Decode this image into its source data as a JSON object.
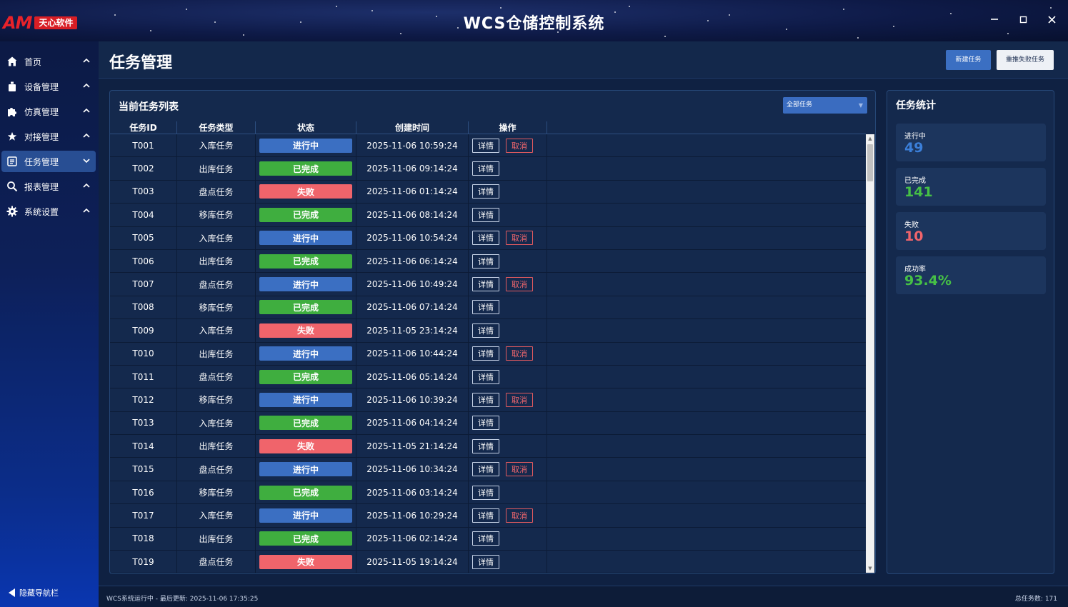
{
  "app": {
    "logo_text": "AM",
    "logo_tag": "天心软件",
    "title": "WCS仓储控制系统",
    "window_controls": [
      "minimize",
      "maximize",
      "close"
    ]
  },
  "sidebar": {
    "items": [
      {
        "label": "首页",
        "icon": "home-icon",
        "active": false
      },
      {
        "label": "设备管理",
        "icon": "device-icon",
        "active": false
      },
      {
        "label": "仿真管理",
        "icon": "puzzle-icon",
        "active": false
      },
      {
        "label": "对接管理",
        "icon": "star-icon",
        "active": false
      },
      {
        "label": "任务管理",
        "icon": "list-icon",
        "active": true
      },
      {
        "label": "报表管理",
        "icon": "search-icon",
        "active": false
      },
      {
        "label": "系统设置",
        "icon": "gear-icon",
        "active": false
      }
    ],
    "collapse_label": "隐藏导航栏"
  },
  "header": {
    "title": "任务管理",
    "new_task_label": "新建任务",
    "retry_failed_label": "重推失败任务"
  },
  "task_panel": {
    "title": "当前任务列表",
    "filter_value": "全部任务",
    "columns": [
      "任务ID",
      "任务类型",
      "状态",
      "创建时间",
      "操作"
    ],
    "detail_label": "详情",
    "cancel_label": "取消",
    "rows": [
      {
        "id": "T001",
        "type": "入库任务",
        "status": "进行中",
        "status_kind": "running",
        "created": "2025-11-06 10:59:24",
        "cancellable": true
      },
      {
        "id": "T002",
        "type": "出库任务",
        "status": "已完成",
        "status_kind": "done",
        "created": "2025-11-06 09:14:24",
        "cancellable": false
      },
      {
        "id": "T003",
        "type": "盘点任务",
        "status": "失败",
        "status_kind": "failed",
        "created": "2025-11-06 01:14:24",
        "cancellable": false
      },
      {
        "id": "T004",
        "type": "移库任务",
        "status": "已完成",
        "status_kind": "done",
        "created": "2025-11-06 08:14:24",
        "cancellable": false
      },
      {
        "id": "T005",
        "type": "入库任务",
        "status": "进行中",
        "status_kind": "running",
        "created": "2025-11-06 10:54:24",
        "cancellable": true
      },
      {
        "id": "T006",
        "type": "出库任务",
        "status": "已完成",
        "status_kind": "done",
        "created": "2025-11-06 06:14:24",
        "cancellable": false
      },
      {
        "id": "T007",
        "type": "盘点任务",
        "status": "进行中",
        "status_kind": "running",
        "created": "2025-11-06 10:49:24",
        "cancellable": true
      },
      {
        "id": "T008",
        "type": "移库任务",
        "status": "已完成",
        "status_kind": "done",
        "created": "2025-11-06 07:14:24",
        "cancellable": false
      },
      {
        "id": "T009",
        "type": "入库任务",
        "status": "失败",
        "status_kind": "failed",
        "created": "2025-11-05 23:14:24",
        "cancellable": false
      },
      {
        "id": "T010",
        "type": "出库任务",
        "status": "进行中",
        "status_kind": "running",
        "created": "2025-11-06 10:44:24",
        "cancellable": true
      },
      {
        "id": "T011",
        "type": "盘点任务",
        "status": "已完成",
        "status_kind": "done",
        "created": "2025-11-06 05:14:24",
        "cancellable": false
      },
      {
        "id": "T012",
        "type": "移库任务",
        "status": "进行中",
        "status_kind": "running",
        "created": "2025-11-06 10:39:24",
        "cancellable": true
      },
      {
        "id": "T013",
        "type": "入库任务",
        "status": "已完成",
        "status_kind": "done",
        "created": "2025-11-06 04:14:24",
        "cancellable": false
      },
      {
        "id": "T014",
        "type": "出库任务",
        "status": "失败",
        "status_kind": "failed",
        "created": "2025-11-05 21:14:24",
        "cancellable": false
      },
      {
        "id": "T015",
        "type": "盘点任务",
        "status": "进行中",
        "status_kind": "running",
        "created": "2025-11-06 10:34:24",
        "cancellable": true
      },
      {
        "id": "T016",
        "type": "移库任务",
        "status": "已完成",
        "status_kind": "done",
        "created": "2025-11-06 03:14:24",
        "cancellable": false
      },
      {
        "id": "T017",
        "type": "入库任务",
        "status": "进行中",
        "status_kind": "running",
        "created": "2025-11-06 10:29:24",
        "cancellable": true
      },
      {
        "id": "T018",
        "type": "出库任务",
        "status": "已完成",
        "status_kind": "done",
        "created": "2025-11-06 02:14:24",
        "cancellable": false
      },
      {
        "id": "T019",
        "type": "盘点任务",
        "status": "失败",
        "status_kind": "failed",
        "created": "2025-11-05 19:14:24",
        "cancellable": false
      }
    ]
  },
  "stats": {
    "title": "任务统计",
    "cards": [
      {
        "label": "进行中",
        "value": "49",
        "color": "#3b7fd9"
      },
      {
        "label": "已完成",
        "value": "141",
        "color": "#46c046"
      },
      {
        "label": "失败",
        "value": "10",
        "color": "#f0646b"
      },
      {
        "label": "成功率",
        "value": "93.4%",
        "color": "#46c046"
      }
    ]
  },
  "statusbar": {
    "left": "WCS系统运行中 - 最后更新: 2025-11-06 17:35:25",
    "right": "总任务数: 171"
  },
  "colors": {
    "running": "#3b6fc2",
    "done": "#3fae3f",
    "failed": "#f0646b",
    "cancel": "#e35a5f"
  }
}
